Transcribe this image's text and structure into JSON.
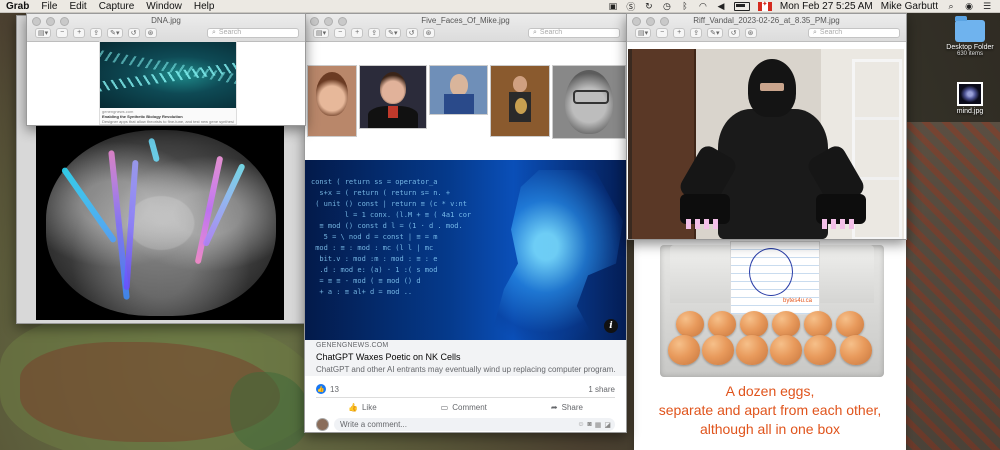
{
  "menubar": {
    "app": "Grab",
    "menus": [
      "File",
      "Edit",
      "Capture",
      "Window",
      "Help"
    ],
    "datetime": "Mon Feb 27  5:25 AM",
    "user": "Mike Garbutt"
  },
  "windows": {
    "dna": {
      "title": "DNA.jpg",
      "search_placeholder": "Search",
      "card": {
        "source": "genengnews.com",
        "headline": "Enabling the Synthetic Biology Revolution",
        "subtext": "Designer apps that allow theorists to fine-tune, and test new gene synthesis techniques at low cost"
      }
    },
    "faces": {
      "title": "Five_Faces_Of_Mike.jpg",
      "search_placeholder": "Search",
      "post": {
        "source": "GENENGNEWS.COM",
        "title": "ChatGPT Waxes Poetic on NK Cells",
        "subtitle": "ChatGPT and other AI entrants may eventually wind up replacing computer program...",
        "like_count": "13",
        "shares": "1 share",
        "actions": [
          "Like",
          "Comment",
          "Share"
        ],
        "comment_placeholder": "Write a comment..."
      }
    },
    "riff": {
      "title": "Riff_Vandal_2023-02-26_at_8.35_PM.jpg",
      "search_placeholder": "Search"
    },
    "eggs": {
      "watermark": "bytes4u.ca",
      "caption_lines": [
        "A dozen eggs,",
        "separate and apart from each other,",
        "although all in one box"
      ]
    }
  },
  "desktop": {
    "folder": {
      "label": "Desktop Folder",
      "sub": "630 items"
    },
    "file": {
      "label": "mind.jpg"
    }
  },
  "colors": {
    "caption_orange": "#e0541c",
    "facebook_blue": "#1877f2"
  }
}
